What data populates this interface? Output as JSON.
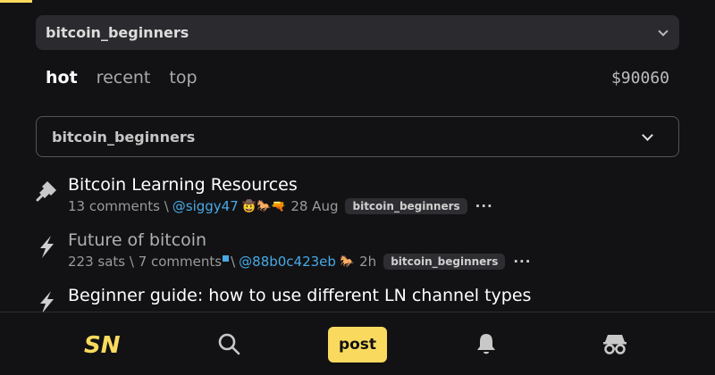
{
  "header": {
    "sub_select": "bitcoin_beginners"
  },
  "tabs": [
    {
      "label": "hot"
    },
    {
      "label": "recent"
    },
    {
      "label": "top"
    }
  ],
  "price": "$90060",
  "filter_select": "bitcoin_beginners",
  "items": [
    {
      "icon": "pin-icon",
      "title": "Bitcoin Learning Resources",
      "meta_prefix": "13 comments \\",
      "user": "@siggy47",
      "user_glyphs": "🤠🐎🔫",
      "time": "28 Aug",
      "badge": "bitcoin_beginners",
      "more": "···"
    },
    {
      "icon": "lightning-icon",
      "title": "Future of bitcoin",
      "meta_prefix": "223 sats \\ 7 comments",
      "user": "@88b0c423eb",
      "user_glyphs": "🐎",
      "time": "2h",
      "badge": "bitcoin_beginners",
      "more": "···"
    },
    {
      "icon": "lightning-icon",
      "title": "Beginner guide: how to use different LN channel types"
    }
  ],
  "bottom_nav": {
    "logo": "SN",
    "search_icon": "search-icon",
    "post_label": "post",
    "bell_icon": "bell-icon",
    "anon_icon": "anon-icon"
  },
  "colors": {
    "accent": "#fada5e",
    "link": "#48a9e6",
    "background": "#121214"
  }
}
